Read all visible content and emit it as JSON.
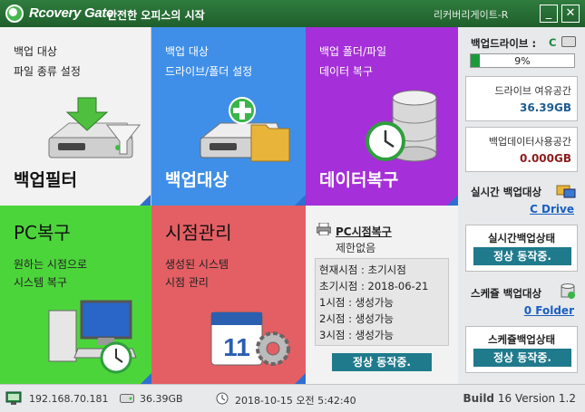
{
  "titlebar": {
    "app_name": "Rcovery Gate",
    "slogan": "안전한 오피스의 시작",
    "window_title": "리커버리게이트-R",
    "minimize": "_",
    "close": "✕"
  },
  "tiles": {
    "filter": {
      "line1": "백업 대상",
      "line2": "파일 종류 설정",
      "title": "백업필터"
    },
    "target": {
      "line1": "백업 대상",
      "line2": "드라이브/폴더 설정",
      "title": "백업대상"
    },
    "restore": {
      "line1": "백업 폴더/파일",
      "line2": "데이터 복구",
      "title": "데이터복구"
    },
    "pc": {
      "title": "PC복구",
      "line1": "원하는 시점으로",
      "line2": "시스템 복구"
    },
    "point": {
      "title": "시점관리",
      "line1": "생성된 시스템",
      "line2": "시점 관리"
    }
  },
  "point_panel": {
    "title": "PC시점복구",
    "subtitle": "제한없음",
    "rows": [
      "현재시점 : 초기시점",
      "초기시점 : 2018-06-21",
      "1시점 : 생성가능",
      "2시점 : 생성가능",
      "3시점 : 생성가능"
    ],
    "status": "정상 동작중."
  },
  "sidebar": {
    "drive_label": "백업드라이브 :",
    "drive_letter": "C",
    "usage_percent": 9,
    "usage_text": "9%",
    "free_label": "드라이브 여유공간",
    "free_value": "36.39GB",
    "used_label": "백업데이터사용공간",
    "used_value": "0.000GB",
    "realtime_target_label": "실시간 백업대상",
    "realtime_target_link": "C Drive",
    "realtime_state_label": "실시간백업상태",
    "realtime_state": "정상 동작중.",
    "schedule_target_label": "스케쥴 백업대상",
    "schedule_target_link": "0 Folder",
    "schedule_state_label": "스케쥴백업상태",
    "schedule_state": "정상 동작중."
  },
  "statusbar": {
    "ip": "192.168.70.181",
    "disk": "36.39GB",
    "datetime": "2018-10-15 오전 5:42:40",
    "build_label": "Build",
    "build_number": "16",
    "version": "Version 1.2"
  },
  "colors": {
    "title_green": "#2f7d3e",
    "tile_blue": "#3f8fe8",
    "tile_purple": "#a52fd8",
    "tile_green": "#4cd53b",
    "tile_red": "#e35f64",
    "status_teal": "#1f7a8c"
  },
  "icons": [
    "recovery-gate-logo-icon",
    "hdd-filter-icon",
    "hdd-add-folder-icon",
    "database-clock-icon",
    "pc-clock-icon",
    "calendar-gear-icon",
    "printer-icon",
    "network-icon",
    "disk-icon",
    "clock-icon"
  ]
}
